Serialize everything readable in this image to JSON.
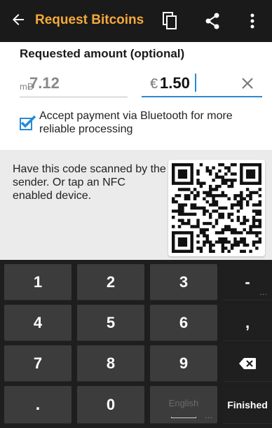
{
  "actionbar": {
    "title": "Request Bitcoins"
  },
  "amount": {
    "label": "Requested amount (optional)",
    "btc": {
      "prefix": "mɃ",
      "value": "7.12"
    },
    "fiat": {
      "symbol": "€",
      "value": "1.50"
    }
  },
  "bluetooth": {
    "checked": true,
    "label": "Accept payment via Bluetooth for more reliable processing"
  },
  "qr": {
    "instruction": "Have this code scanned by the sender. Or tap an NFC enabled device."
  },
  "keyboard": {
    "rows": [
      [
        "1",
        "2",
        "3",
        "-"
      ],
      [
        "4",
        "5",
        "6",
        ","
      ],
      [
        "7",
        "8",
        "9",
        "backspace"
      ],
      [
        ".",
        "0",
        "English",
        "Finished"
      ]
    ]
  },
  "colors": {
    "accent": "#f5a93a",
    "focus": "#2a8ad4",
    "actionbar": "#1a1a1a",
    "keyboard_bg": "#1e1e1e",
    "key_bg": "#3c3c3c"
  }
}
